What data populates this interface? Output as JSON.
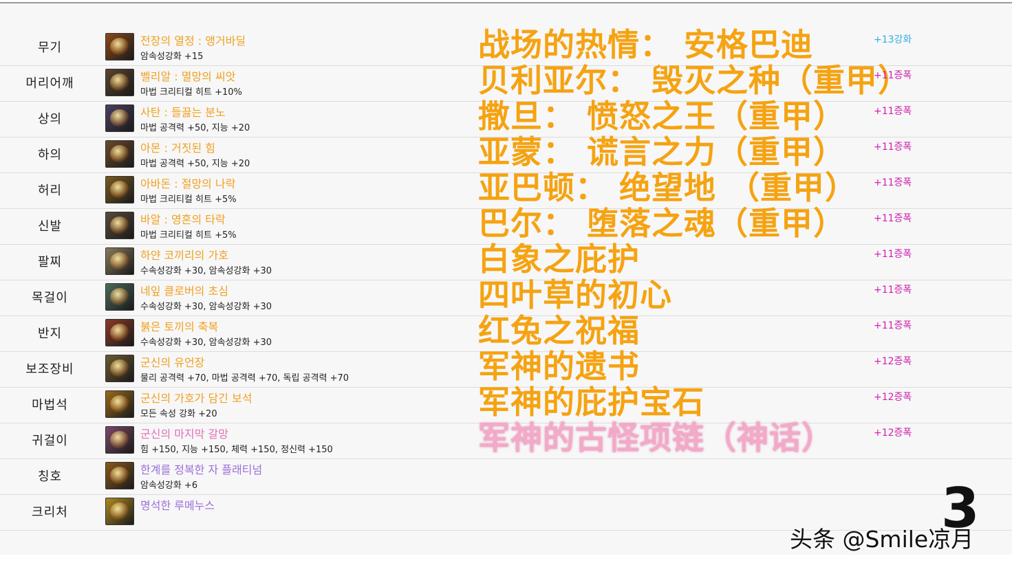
{
  "rows": [
    {
      "slot": "무기",
      "name": "전장의 열정 : 앵거바딜",
      "name_color": "orange",
      "stat": "암속성강화 +15",
      "cn": "战场的热情： 安格巴迪",
      "cn_style": "orange",
      "enh": "+13강화",
      "enh_style": "cyan",
      "icon_color": "#8a4a1a"
    },
    {
      "slot": "머리어깨",
      "name": "벨리알 : 멸망의 씨앗",
      "name_color": "orange",
      "stat": "마법 크리티컬 히트 +10%",
      "cn": "贝利亚尔： 毁灭之种（重甲）",
      "cn_style": "orange",
      "enh": "+11증폭",
      "enh_style": "magenta",
      "icon_color": "#5a4430"
    },
    {
      "slot": "상의",
      "name": "사탄 : 들끓는 분노",
      "name_color": "orange",
      "stat": "마법 공격력 +50, 지능 +20",
      "cn": "撒旦： 愤怒之王（重甲）",
      "cn_style": "orange",
      "enh": "+11증폭",
      "enh_style": "magenta",
      "icon_color": "#4a4060"
    },
    {
      "slot": "하의",
      "name": "아몬 : 거짓된 힘",
      "name_color": "orange",
      "stat": "마법 공격력 +50, 지능 +20",
      "cn": "亚蒙： 谎言之力（重甲）",
      "cn_style": "orange",
      "enh": "+11증폭",
      "enh_style": "magenta",
      "icon_color": "#6a4a2a"
    },
    {
      "slot": "허리",
      "name": "아바돈 : 절망의 나락",
      "name_color": "orange",
      "stat": "마법 크리티컬 히트 +5%",
      "cn": "亚巴顿： 绝望地 （重甲）",
      "cn_style": "orange",
      "enh": "+11증폭",
      "enh_style": "magenta",
      "icon_color": "#7a5a20"
    },
    {
      "slot": "신발",
      "name": "바알 : 영혼의 타락",
      "name_color": "orange",
      "stat": "마법 크리티컬 히트 +5%",
      "cn": "巴尔： 堕落之魂（重甲）",
      "cn_style": "orange",
      "enh": "+11증폭",
      "enh_style": "magenta",
      "icon_color": "#5a4a3a"
    },
    {
      "slot": "팔찌",
      "name": "하얀 코끼리의 가호",
      "name_color": "orange",
      "stat": "수속성강화 +30, 암속성강화 +30",
      "cn": "白象之庇护",
      "cn_style": "orange",
      "enh": "+11증폭",
      "enh_style": "magenta",
      "icon_color": "#8a7a5a"
    },
    {
      "slot": "목걸이",
      "name": "네잎 클로버의 초심",
      "name_color": "orange",
      "stat": "수속성강화 +30, 암속성강화 +30",
      "cn": "四叶草的初心",
      "cn_style": "orange",
      "enh": "+11증폭",
      "enh_style": "magenta",
      "icon_color": "#4a6a5a"
    },
    {
      "slot": "반지",
      "name": "붉은 토끼의 축복",
      "name_color": "orange",
      "stat": "수속성강화 +30, 암속성강화 +30",
      "cn": "红兔之祝福",
      "cn_style": "orange",
      "enh": "+11증폭",
      "enh_style": "magenta",
      "icon_color": "#8a3a2a"
    },
    {
      "slot": "보조장비",
      "name": "군신의 유언장",
      "name_color": "orange",
      "stat": "물리 공격력 +70, 마법 공격력 +70, 독립 공격력 +70",
      "cn": "军神的遗书",
      "cn_style": "orange",
      "enh": "+12증폭",
      "enh_style": "magenta",
      "icon_color": "#6a5a30"
    },
    {
      "slot": "마법석",
      "name": "군신의 가호가 담긴 보석",
      "name_color": "orange",
      "stat": "모든 속성 강화 +20",
      "cn": "军神的庇护宝石",
      "cn_style": "orange",
      "enh": "+12증폭",
      "enh_style": "magenta",
      "icon_color": "#9a6a1a"
    },
    {
      "slot": "귀걸이",
      "name": "군신의 마지막 갈망",
      "name_color": "pink",
      "stat": "힘 +150, 지능 +150, 체력 +150, 정신력 +150",
      "cn": "军神的古怪项链（神话）",
      "cn_style": "pink",
      "enh": "+12증폭",
      "enh_style": "magenta",
      "icon_color": "#7a4a6a"
    },
    {
      "slot": "칭호",
      "name": "한계를 정복한 자 플래티넘",
      "name_color": "purple",
      "stat": "암속성강화 +6",
      "cn": "",
      "cn_style": "orange",
      "enh": "",
      "enh_style": "magenta",
      "icon_color": "#8a5a1a"
    },
    {
      "slot": "크리처",
      "name": "명석한 루메누스",
      "name_color": "purple",
      "stat": "",
      "cn": "",
      "cn_style": "orange",
      "enh": "",
      "enh_style": "magenta",
      "icon_color": "#b08a20"
    }
  ],
  "overlay": {
    "number": "3",
    "watermark": "头条 @Smile凉月"
  }
}
